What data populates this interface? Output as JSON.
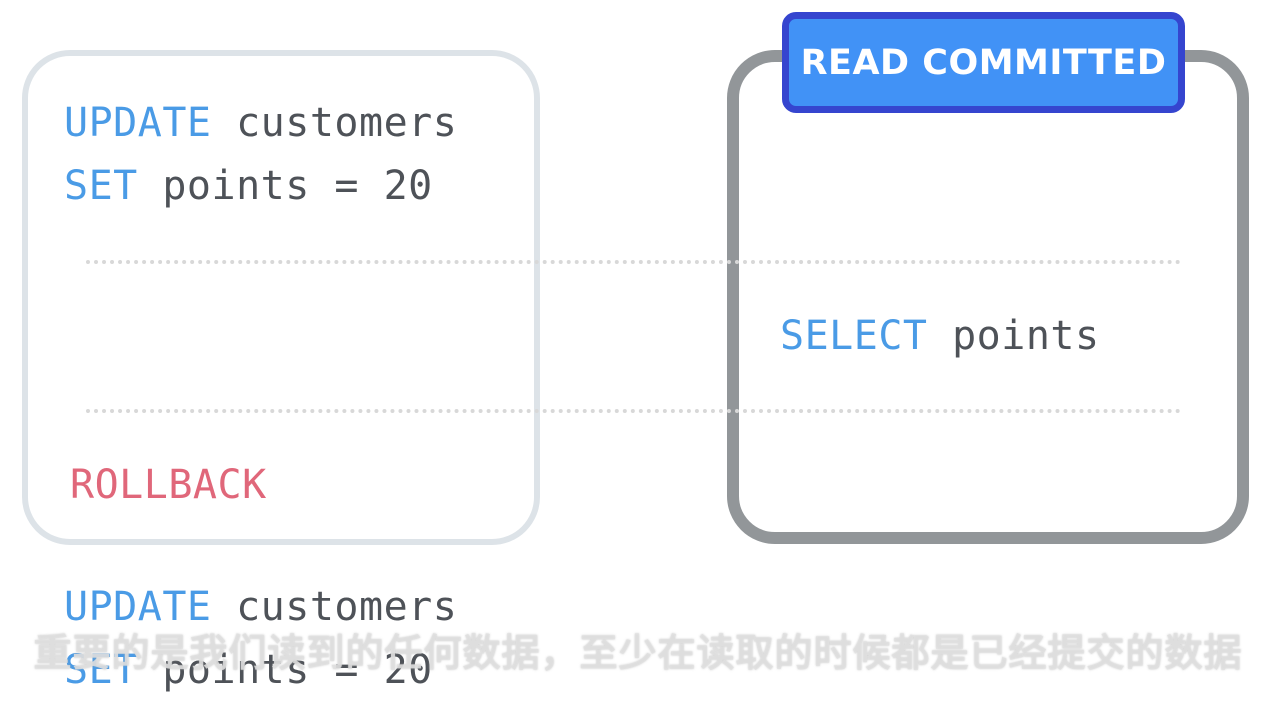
{
  "left_transaction": {
    "update_1": {
      "keyword": "UPDATE",
      "text": " customers"
    },
    "set_1": {
      "keyword": "SET",
      "text": " points = 20"
    },
    "rollback": "ROLLBACK"
  },
  "right_transaction": {
    "badge": "READ COMMITTED",
    "select": {
      "keyword": "SELECT",
      "text": " points"
    }
  },
  "below": {
    "update_2": {
      "keyword": "UPDATE",
      "text": " customers"
    },
    "set_2": {
      "keyword": "SET",
      "text": " points = 20"
    }
  },
  "subtitle": "重要的是我们读到的任何数据，至少在读取的时候都是已经提交的数据",
  "colors": {
    "keyword": "#4a9be6",
    "text": "#4e5258",
    "rollback": "#e0677a",
    "badge_fill": "#4192f6",
    "badge_border": "#3545cf",
    "right_box_border": "#929699",
    "left_box_border": "#dde3e8"
  }
}
